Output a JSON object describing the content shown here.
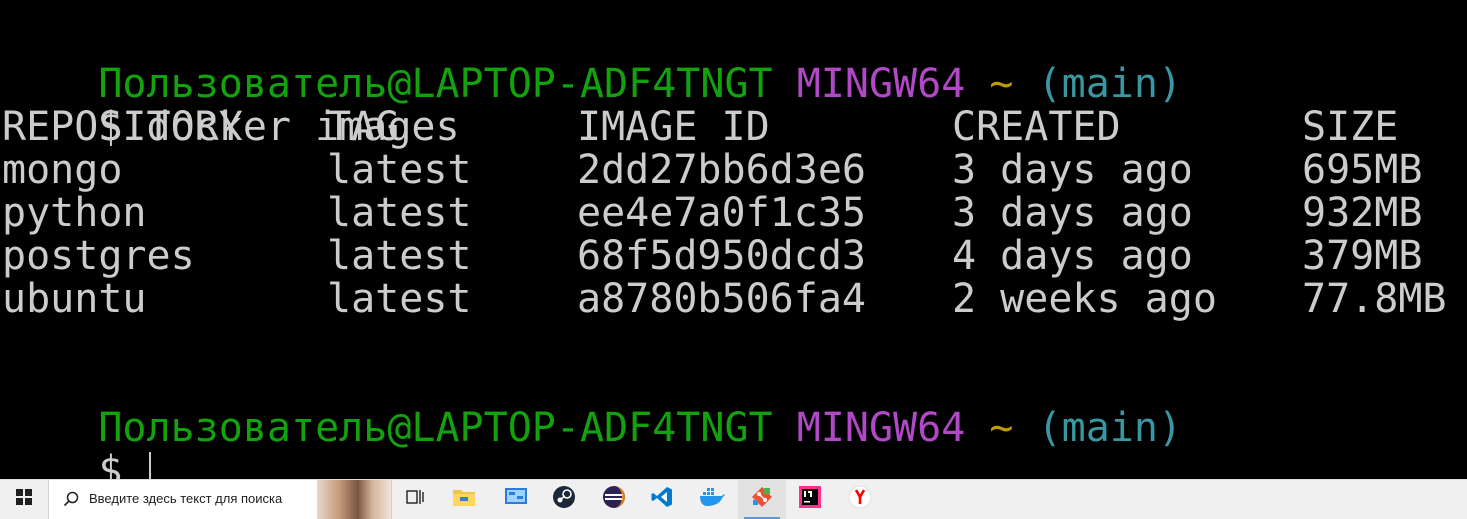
{
  "terminal": {
    "prompt1": {
      "user_host": "Пользователь@LAPTOP-ADF4TNGT",
      "system": "MINGW64",
      "path": "~",
      "branch": "(main)"
    },
    "command": {
      "symbol": "$",
      "text": "docker images"
    },
    "table": {
      "headers": {
        "repository": "REPOSITORY",
        "tag": "TAG",
        "image_id": "IMAGE ID",
        "created": "CREATED",
        "size": "SIZE"
      },
      "rows": [
        {
          "repository": "mongo",
          "tag": "latest",
          "image_id": "2dd27bb6d3e6",
          "created": "3 days ago",
          "size": "695МВ"
        },
        {
          "repository": "python",
          "tag": "latest",
          "image_id": "ee4e7a0f1c35",
          "created": "3 days ago",
          "size": "932МВ"
        },
        {
          "repository": "postgres",
          "tag": "latest",
          "image_id": "68f5d950dcd3",
          "created": "4 days ago",
          "size": "379МВ"
        },
        {
          "repository": "ubuntu",
          "tag": "latest",
          "image_id": "a8780b506fa4",
          "created": "2 weeks ago",
          "size": "77.8МВ"
        }
      ]
    },
    "prompt2": {
      "user_host": "Пользователь@LAPTOP-ADF4TNGT",
      "system": "MINGW64",
      "path": "~",
      "branch": "(main)"
    },
    "input_symbol": "$",
    "colors": {
      "user_host": "#13a10e",
      "system": "#b148c6",
      "path": "#c19c00",
      "branch": "#3a96a0",
      "text": "#cccccc",
      "background": "#000000"
    }
  },
  "taskbar": {
    "search_placeholder": "Введите здесь текст для поиска",
    "icons": [
      "windows-start-icon",
      "search-icon",
      "task-view-icon",
      "file-explorer-icon",
      "control-panel-icon",
      "steam-icon",
      "eclipse-icon",
      "vscode-icon",
      "docker-icon",
      "git-icon",
      "intellij-icon",
      "yandex-browser-icon"
    ]
  }
}
